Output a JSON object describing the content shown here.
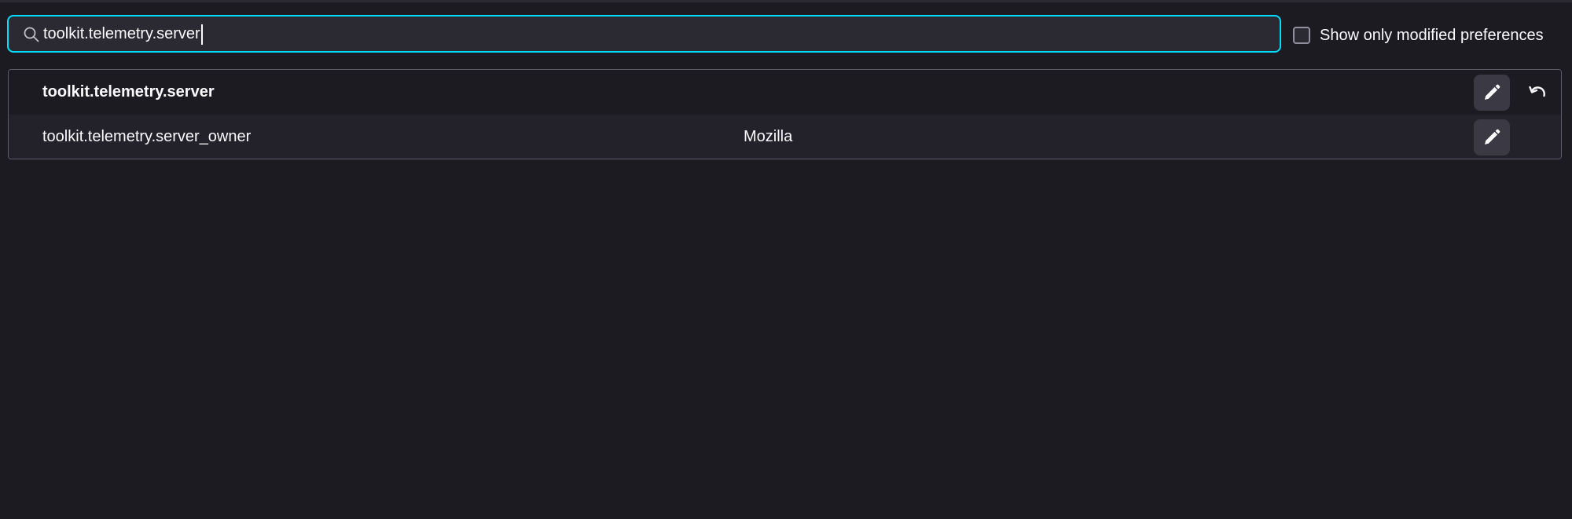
{
  "search": {
    "value": "toolkit.telemetry.server",
    "icon": "search-icon"
  },
  "filter": {
    "label": "Show only modified preferences",
    "checked": false
  },
  "preferences": [
    {
      "name": "toolkit.telemetry.server",
      "value": "",
      "modified": true,
      "actions": [
        "edit-icon",
        "reset-icon"
      ]
    },
    {
      "name": "toolkit.telemetry.server_owner",
      "value": "Mozilla",
      "modified": false,
      "actions": [
        "edit-icon"
      ]
    }
  ],
  "colors": {
    "background": "#1c1b22",
    "accent_focus": "#00ddff",
    "alt_row": "#23222b",
    "button": "#3a3944"
  }
}
